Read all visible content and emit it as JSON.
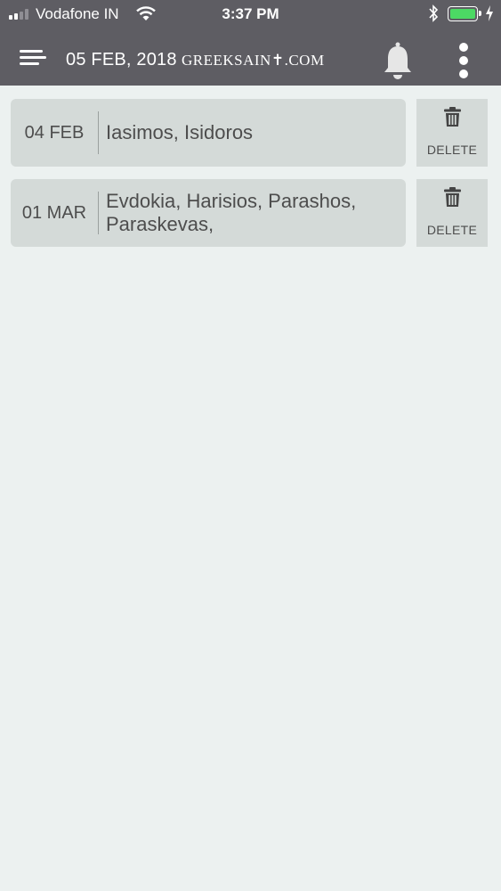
{
  "status_bar": {
    "carrier": "Vodafone IN",
    "time": "3:37 PM",
    "battery_icon": "battery-charging-icon",
    "battery_color": "#4cd964"
  },
  "header": {
    "date": "05 FEB, 2018",
    "site": "GREEKSAIN✝.COM",
    "background": "#5e5d63"
  },
  "rows": [
    {
      "date": "04 FEB",
      "names": "Iasimos, Isidoros",
      "delete_label": "DELETE"
    },
    {
      "date": "01 MAR",
      "names": "Evdokia, Harisios, Parashos, Paraskevas,",
      "delete_label": "DELETE"
    }
  ],
  "icons": {
    "menu": "hamburger-menu-icon",
    "bell": "bell-icon",
    "more": "more-vertical-icon",
    "delete": "trash-icon"
  }
}
